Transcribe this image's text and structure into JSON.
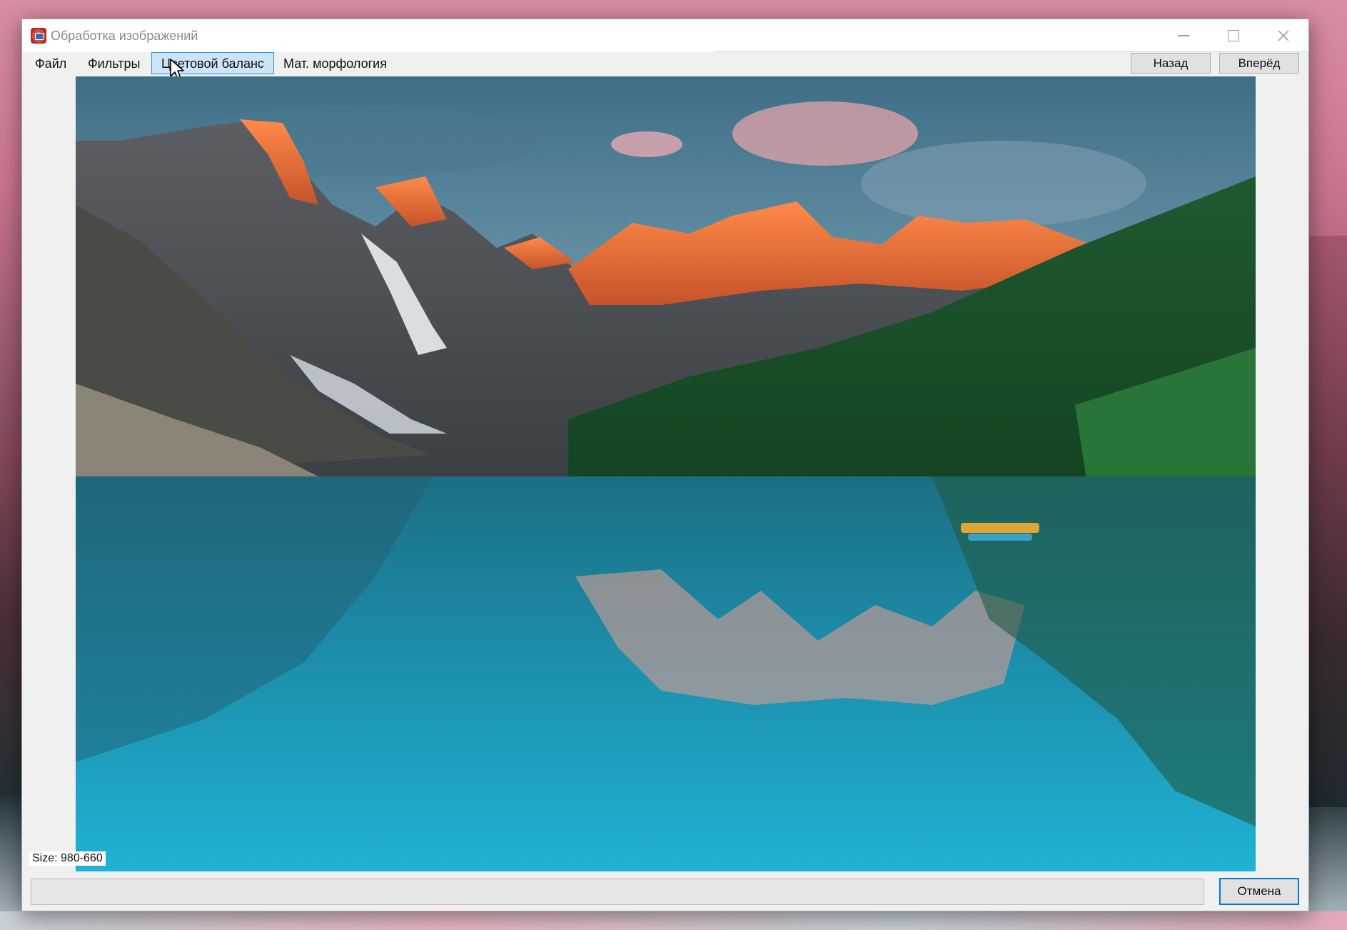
{
  "window": {
    "title": "Обработка изображений",
    "icon": "app-image-icon"
  },
  "menu": {
    "items": [
      {
        "label": "Файл",
        "active": false
      },
      {
        "label": "Фильтры",
        "active": false
      },
      {
        "label": "Цветовой баланс",
        "active": true
      },
      {
        "label": "Мат. морфология",
        "active": false
      }
    ]
  },
  "nav": {
    "back_label": "Назад",
    "forward_label": "Вперёд"
  },
  "image": {
    "description_icon": "landscape-image",
    "size_label": "Size: 980-660"
  },
  "footer": {
    "cancel_label": "Отмена"
  },
  "colors": {
    "accent": "#0078d7",
    "menu_active_bg": "#cce4f7",
    "menu_active_border": "#3d8fd8"
  }
}
